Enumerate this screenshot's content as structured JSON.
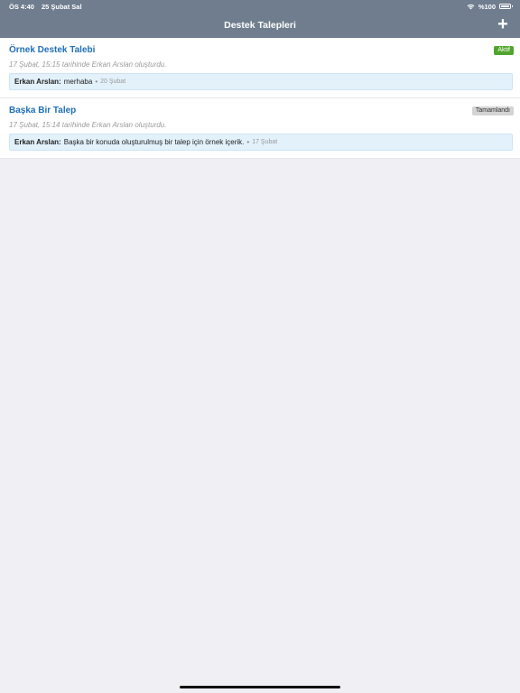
{
  "status_bar": {
    "time": "ÖS 4:40",
    "date": "25 Şubat Sal",
    "battery": "%100"
  },
  "nav": {
    "title": "Destek Talepleri",
    "add_label": "+"
  },
  "tickets": [
    {
      "title": "Örnek Destek Talebi",
      "status": "Aktif",
      "meta": "17 Şubat, 15:15 tarihinde Erkan Arslan oluşturdu.",
      "message": {
        "author": "Erkan Arslan:",
        "text": "merhaba",
        "separator": "•",
        "date": "20 Şubat"
      }
    },
    {
      "title": "Başka Bir Talep",
      "status": "Tamamlandı",
      "meta": "17 Şubat, 15:14 tarihinde Erkan Arslan oluşturdu.",
      "message": {
        "author": "Erkan Arslan:",
        "text": "Başka bir konuda oluşturulmuş bir talep için örnek içerik.",
        "separator": "•",
        "date": "17 Şubat"
      }
    }
  ],
  "colors": {
    "navbar": "#6f7d8e",
    "title_link": "#1f6fb9",
    "status_active": "#52a42e",
    "status_done": "#d4d4d4",
    "message_bg": "#e3f1fb",
    "background": "#efeff4"
  }
}
